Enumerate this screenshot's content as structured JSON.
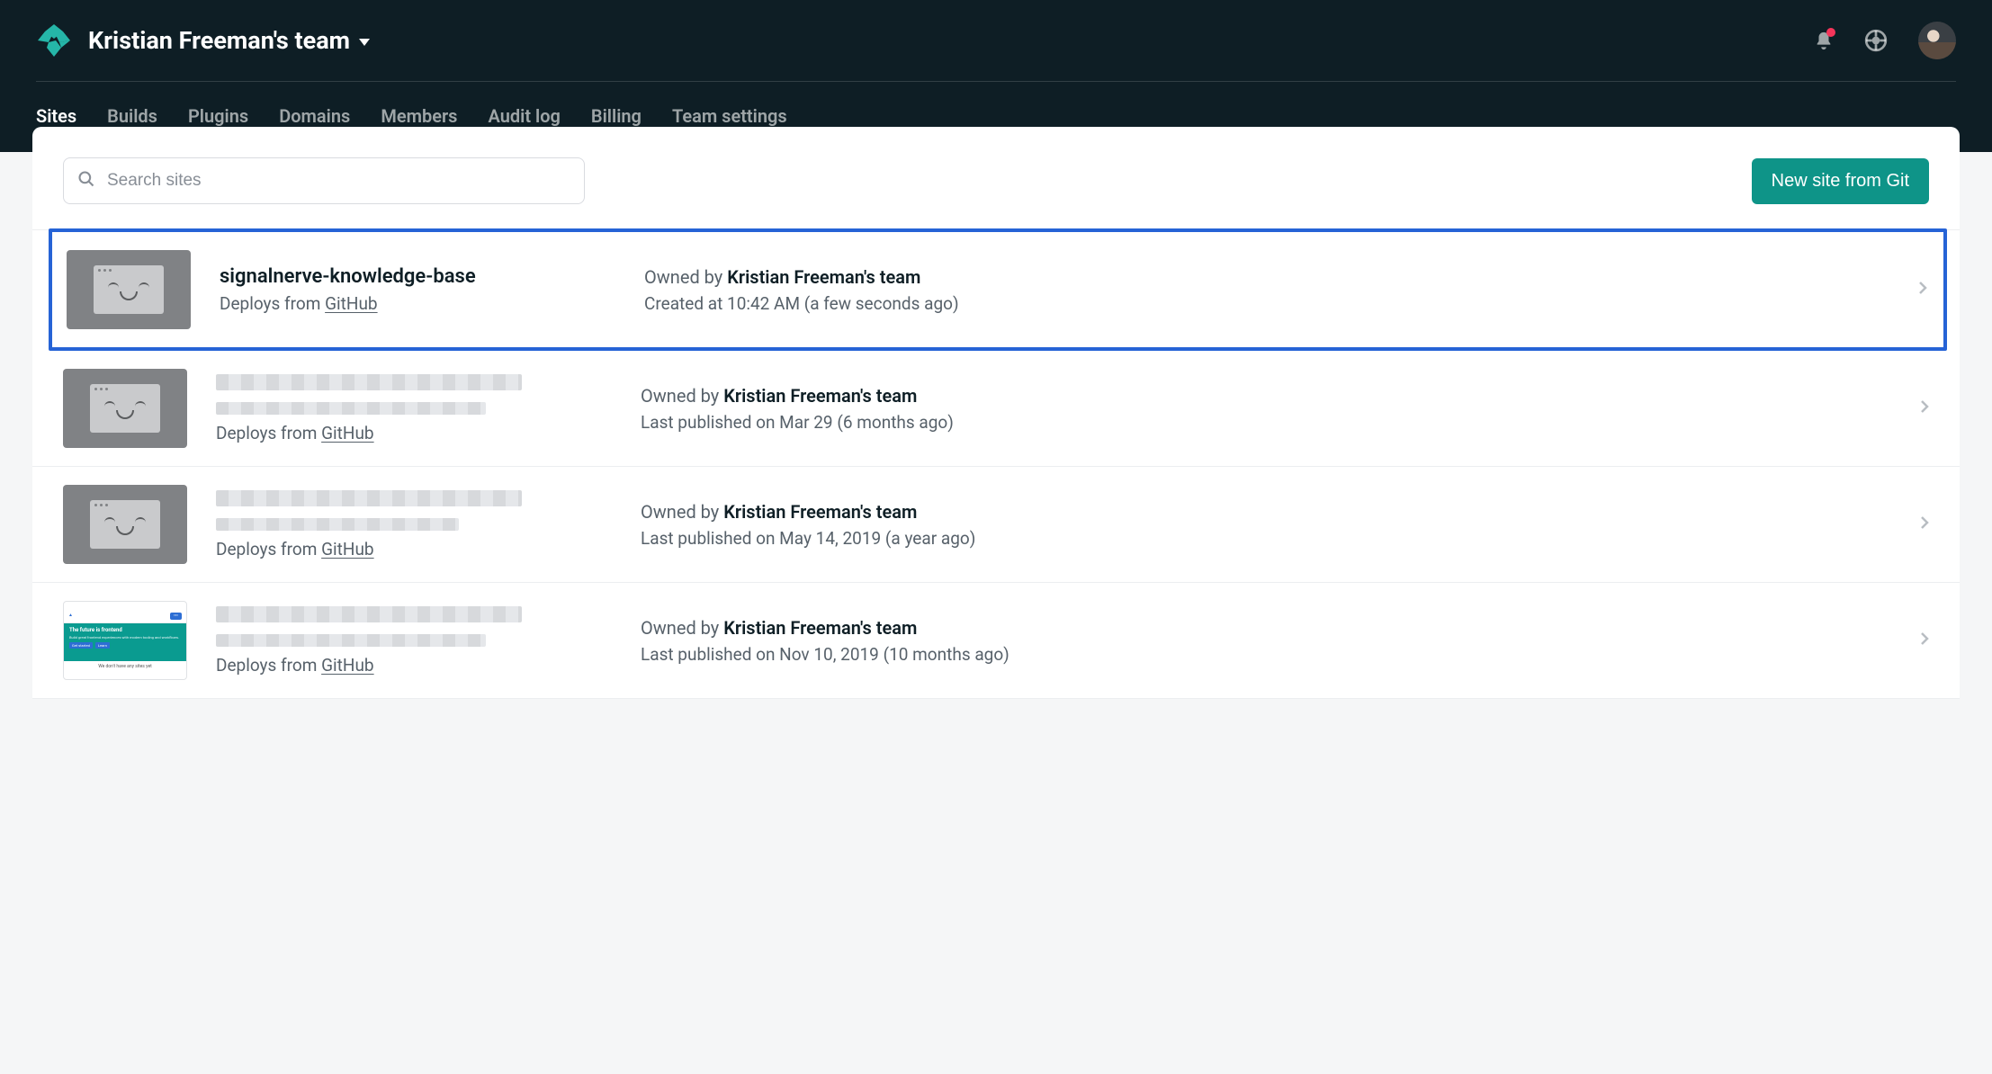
{
  "header": {
    "team_name": "Kristian Freeman's team",
    "nav_tabs": [
      {
        "label": "Sites",
        "active": true
      },
      {
        "label": "Builds",
        "active": false
      },
      {
        "label": "Plugins",
        "active": false
      },
      {
        "label": "Domains",
        "active": false
      },
      {
        "label": "Members",
        "active": false
      },
      {
        "label": "Audit log",
        "active": false
      },
      {
        "label": "Billing",
        "active": false
      },
      {
        "label": "Team settings",
        "active": false
      }
    ]
  },
  "search": {
    "placeholder": "Search sites"
  },
  "actions": {
    "new_site_label": "New site from Git"
  },
  "deploy_meta": {
    "prefix": "Deploys from ",
    "source": "GitHub"
  },
  "sites": [
    {
      "name": "signalnerve-knowledge-base",
      "redacted": false,
      "highlighted": true,
      "thumb": "default",
      "owner_prefix": "Owned by ",
      "owner": "Kristian Freeman's team",
      "time_text": "Created at 10:42 AM (a few seconds ago)"
    },
    {
      "name": "",
      "redacted": true,
      "redact_style": "long",
      "highlighted": false,
      "thumb": "default",
      "owner_prefix": "Owned by ",
      "owner": "Kristian Freeman's team",
      "time_text": "Last published on Mar 29 (6 months ago)"
    },
    {
      "name": "",
      "redacted": true,
      "redact_style": "med",
      "highlighted": false,
      "thumb": "default",
      "owner_prefix": "Owned by ",
      "owner": "Kristian Freeman's team",
      "time_text": "Last published on May 14, 2019 (a year ago)"
    },
    {
      "name": "",
      "redacted": true,
      "redact_style": "long",
      "highlighted": false,
      "thumb": "custom",
      "owner_prefix": "Owned by ",
      "owner": "Kristian Freeman's team",
      "time_text": "Last published on Nov 10, 2019 (10 months ago)"
    }
  ],
  "colors": {
    "header_bg": "#0e1e25",
    "accent": "#0e9488",
    "highlight_border": "#2663d6",
    "notification": "#f5355a"
  }
}
